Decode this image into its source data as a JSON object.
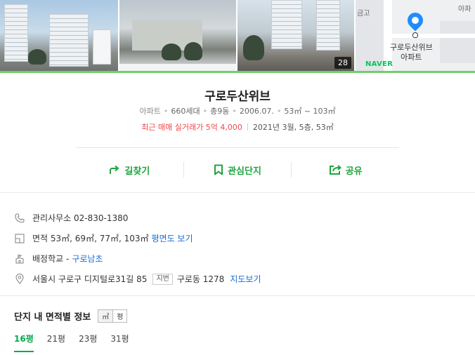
{
  "photos": {
    "count_badge": "28"
  },
  "map": {
    "label_line1": "구로두산위브",
    "label_line2": "아파트",
    "road_label": "금고",
    "corner_label": "아파",
    "logo": "NAVER"
  },
  "complex": {
    "name": "구로두산위브",
    "type": "아파트",
    "households": "660세대",
    "buildings": "총9동",
    "built": "2006.07.",
    "area_range": "53㎡ ~ 103㎡",
    "recent_deal": "최근 매매 실거래가 5억 4,000",
    "deal_detail": "2021년 3월, 5층, 53㎡"
  },
  "actions": {
    "directions": "길찾기",
    "favorite": "관심단지",
    "share": "공유"
  },
  "details": {
    "office": "관리사무소 02-830-1380",
    "area_text": "면적 53㎡, 69㎡, 77㎡, 103㎡",
    "floorplan_link": "평면도 보기",
    "school_text": "배정학교 -",
    "school_link": "구로남초",
    "address": "서울시 구로구 디지털로31길 85",
    "lot_tag": "지번",
    "lot_address": "구로동 1278",
    "map_link": "지도보기"
  },
  "area_section": {
    "title": "단지 내 면적별 정보",
    "unit_m2": "㎡",
    "unit_pyeong": "평",
    "tabs": [
      "16평",
      "21평",
      "23평",
      "31평"
    ]
  },
  "colors": {
    "green_accent": "#03a94d",
    "red_deal": "#f04848",
    "link_blue": "#1b6cd6",
    "pin_blue": "#1e8dff"
  }
}
